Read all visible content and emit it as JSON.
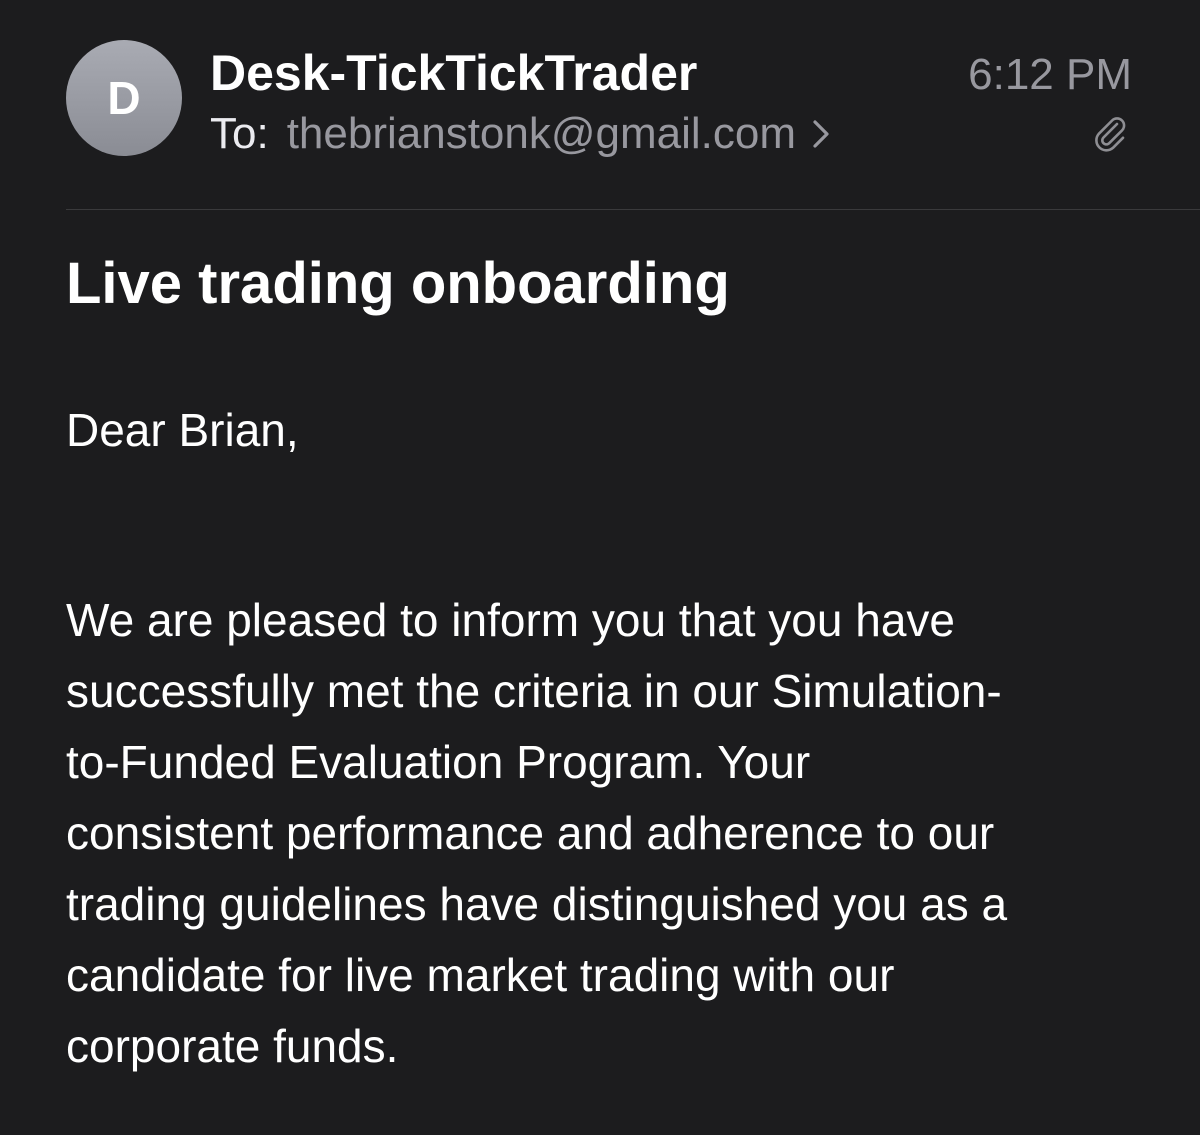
{
  "header": {
    "avatar_initial": "D",
    "sender": "Desk-TickTickTrader",
    "to_label": "To:",
    "to_address": "thebrianstonk@gmail.com",
    "time": "6:12 PM",
    "attachment_icon": "paperclip-icon",
    "chevron_icon": "chevron-right-icon"
  },
  "email": {
    "subject": "Live trading onboarding",
    "greeting": "Dear Brian,",
    "body_lines": [
      "We are pleased to inform you that you have",
      "successfully met the criteria in our Simulation-",
      "to-Funded Evaluation Program. Your",
      "consistent performance and adherence to our",
      "trading guidelines have distinguished you as a",
      "candidate for live market trading with our",
      "corporate funds."
    ]
  },
  "colors": {
    "background": "#1c1c1e",
    "primary_text": "#ffffff",
    "secondary_text": "#98989f",
    "divider": "#3a3a3c",
    "avatar": "#9a9ca4"
  }
}
